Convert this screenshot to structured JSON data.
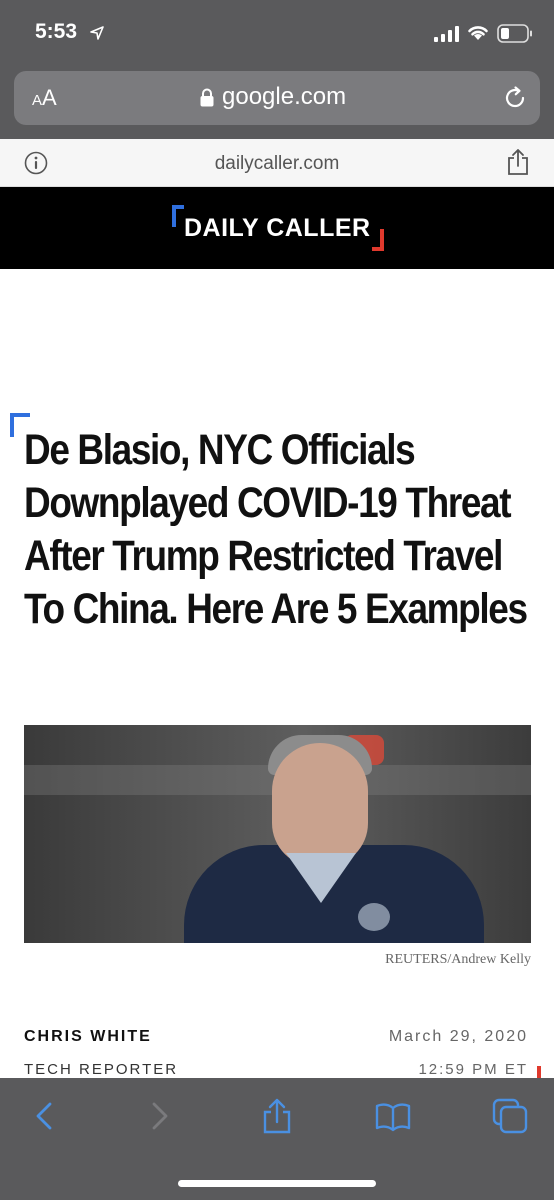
{
  "status_bar": {
    "time": "5:53"
  },
  "browser": {
    "aa_label_small": "A",
    "aa_label_large": "A",
    "url": "google.com"
  },
  "amp_header": {
    "domain": "dailycaller.com"
  },
  "site": {
    "logo_text": "DAILY CALLER"
  },
  "article": {
    "headline": "De Blasio, NYC Officials Downplayed COVID-19 Threat After Trump Restricted Travel To China. Here Are 5 Examples",
    "photo_credit": "REUTERS/Andrew Kelly",
    "author": "CHRIS WHITE",
    "author_role": "TECH REPORTER",
    "date": "March 29, 2020",
    "time": "12:59 PM ET"
  },
  "colors": {
    "brand_blue": "#2f6fde",
    "brand_red": "#e0392d",
    "ios_blue": "#4a90e2"
  }
}
